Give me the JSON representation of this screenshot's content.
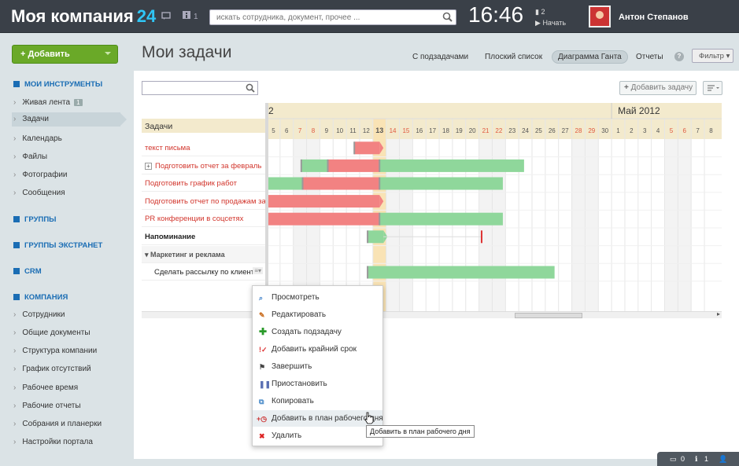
{
  "header": {
    "brand": "Моя компания",
    "brand_num": "24",
    "msg_count": "1",
    "search_placeholder": "искать сотрудника, документ, прочее ...",
    "time": "16:46",
    "flag_count": "2",
    "start_label": "Начать",
    "user_name": "Антон Степанов"
  },
  "sidebar": {
    "add_label": "Добавить",
    "sections": [
      {
        "label": "Мои инструменты",
        "items": [
          {
            "label": "Живая лента",
            "badge": "1"
          },
          {
            "label": "Задачи"
          },
          {
            "label": "Календарь"
          },
          {
            "label": "Файлы"
          },
          {
            "label": "Фотографии"
          },
          {
            "label": "Сообщения"
          }
        ]
      },
      {
        "label": "Группы",
        "items": []
      },
      {
        "label": "Группы экстранет",
        "items": []
      },
      {
        "label": "CRM",
        "items": []
      },
      {
        "label": "Компания",
        "items": [
          {
            "label": "Сотрудники"
          },
          {
            "label": "Общие документы"
          },
          {
            "label": "Структура компании"
          },
          {
            "label": "График отсутствий"
          },
          {
            "label": "Рабочее время"
          },
          {
            "label": "Рабочие отчеты"
          },
          {
            "label": "Собрания и планерки"
          },
          {
            "label": "Настройки портала"
          }
        ]
      }
    ]
  },
  "page": {
    "title": "Мои задачи",
    "views": [
      "С подзадачами",
      "Плоский список",
      "Диаграмма Ганта",
      "Отчеты"
    ],
    "active_view": "Диаграмма Ганта",
    "help": "?",
    "filter_label": "Фильтр",
    "add_task_label": "Добавить задачу"
  },
  "gantt": {
    "tasks_header": "Задачи",
    "month_prev_fragment": "2",
    "month_next": "Май 2012",
    "days": [
      "5",
      "6",
      "7",
      "8",
      "9",
      "10",
      "11",
      "12",
      "13",
      "14",
      "15",
      "16",
      "17",
      "18",
      "19",
      "20",
      "21",
      "22",
      "23",
      "24",
      "25",
      "26",
      "27",
      "28",
      "29",
      "30",
      "1",
      "2",
      "3",
      "4",
      "5",
      "6",
      "7",
      "8"
    ],
    "weekend_days_index": [
      2,
      3,
      9,
      10,
      16,
      17,
      23,
      24,
      30,
      31
    ],
    "today_index": 8,
    "tasks": [
      {
        "label": "текст письма",
        "color": "red",
        "bars": [
          {
            "start": 6.6,
            "end": 8.5,
            "type": "overdue",
            "arrow": true
          }
        ]
      },
      {
        "label": "Подготовить отчет за февраль",
        "color": "red",
        "expand": true,
        "bars": [
          {
            "start": 2.6,
            "end": 4.6,
            "type": "done"
          },
          {
            "start": 4.6,
            "end": 8.5,
            "type": "overdue"
          },
          {
            "start": 8.5,
            "end": 19.4,
            "type": "done"
          }
        ]
      },
      {
        "label": "Подготовить график работ",
        "color": "red",
        "bars": [
          {
            "start": 0,
            "end": 2.7,
            "type": "done"
          },
          {
            "start": 2.7,
            "end": 8.5,
            "type": "overdue"
          },
          {
            "start": 8.5,
            "end": 17.8,
            "type": "done"
          }
        ]
      },
      {
        "label": "Подготовить отчет по продажам за ма",
        "color": "red",
        "bars": [
          {
            "start": 0,
            "end": 8.5,
            "type": "overdue",
            "arrow": true
          }
        ]
      },
      {
        "label": "PR конференции в соцсетях",
        "color": "red",
        "bars": [
          {
            "start": 0,
            "end": 8.5,
            "type": "overdue"
          },
          {
            "start": 8.5,
            "end": 17.8,
            "type": "done"
          }
        ]
      },
      {
        "label": "Напоминание",
        "color": "dark",
        "bars": [
          {
            "start": 7.6,
            "end": 8.8,
            "type": "done",
            "arrow": true
          }
        ],
        "deadline": 16.2
      },
      {
        "label": "Маркетинг и реклама",
        "color": "group",
        "bars": []
      },
      {
        "label": "Сделать рассылку по клиента",
        "color": "dark",
        "bars": [
          {
            "start": 7.6,
            "end": 21.7,
            "type": "done"
          }
        ]
      }
    ]
  },
  "context_menu": {
    "items": [
      {
        "label": "Просмотреть",
        "icon": "magnifier-icon"
      },
      {
        "label": "Редактировать",
        "icon": "pencil-icon"
      },
      {
        "label": "Создать подзадачу",
        "icon": "plus-icon"
      },
      {
        "label": "Добавить крайний срок",
        "icon": "deadline-icon"
      },
      {
        "label": "Завершить",
        "icon": "finish-flag-icon"
      },
      {
        "label": "Приостановить",
        "icon": "pause-icon"
      },
      {
        "label": "Копировать",
        "icon": "copy-icon"
      },
      {
        "label": "Добавить в план рабочего дня",
        "icon": "plan-icon"
      },
      {
        "label": "Удалить",
        "icon": "delete-icon"
      }
    ],
    "tooltip": "Добавить в план рабочего дня"
  },
  "footer": {
    "chat_count": "0",
    "info_count": "1"
  },
  "colors": {
    "topbar": "#3a4048",
    "accent": "#2fc6f6",
    "add_green": "#6aa928",
    "done_bar": "#8fd79b",
    "overdue_bar": "#f28282",
    "today": "#f9e3b5",
    "header_bg": "#f3eacd",
    "weekend_text": "#e0593f"
  }
}
